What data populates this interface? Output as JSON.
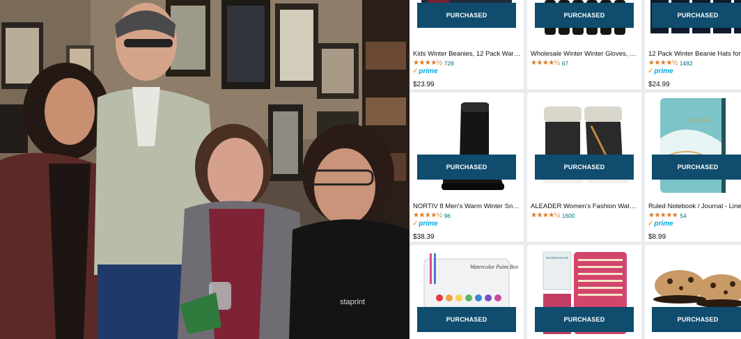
{
  "products": [
    {
      "title": "Kids Winter Beanies, 12 Pack War…",
      "stars": "★★★★½",
      "reviews": "728",
      "prime": "prime",
      "price": "$23.99",
      "status": "PURCHASED"
    },
    {
      "title": "Wholesale Winter Winter Gloves, …",
      "stars": "★★★★½",
      "reviews": "67",
      "prime": "",
      "price": "",
      "status": "PURCHASED"
    },
    {
      "title": "12 Pack Winter Beanie Hats for",
      "stars": "★★★★½",
      "reviews": "1482",
      "prime": "prime",
      "price": "$24.99",
      "status": "PURCHASED"
    },
    {
      "title": "NORTIV 8 Men's Warm Winter Sno…",
      "stars": "★★★★½",
      "reviews": "96",
      "prime": "prime",
      "price": "$38.39",
      "status": "PURCHASED"
    },
    {
      "title": "ALEADER Women's Fashion Water…",
      "stars": "★★★★½",
      "reviews": "1600",
      "prime": "",
      "price": "",
      "status": "PURCHASED"
    },
    {
      "title": "Ruled Notebook / Journal - Line",
      "stars": "★★★★★",
      "reviews": "54",
      "prime": "prime",
      "price": "$8.99",
      "status": "PURCHASED"
    },
    {
      "title": "",
      "stars": "",
      "reviews": "",
      "prime": "",
      "price": "",
      "status": "PURCHASED"
    },
    {
      "title": "",
      "stars": "",
      "reviews": "",
      "prime": "",
      "price": "",
      "status": "PURCHASED"
    },
    {
      "title": "",
      "stars": "",
      "reviews": "",
      "prime": "",
      "price": "",
      "status": "PURCHASED"
    }
  ],
  "thumb_text": {
    "paint_box": "Watercolor Paint Box",
    "watercolor_label": "WATERCOLOR",
    "notebook_script": "Notebook"
  },
  "colors": {
    "purchased_bg": "#0f4c6e",
    "star": "#de7921",
    "link": "#007185",
    "prime": "#00a8e1"
  }
}
